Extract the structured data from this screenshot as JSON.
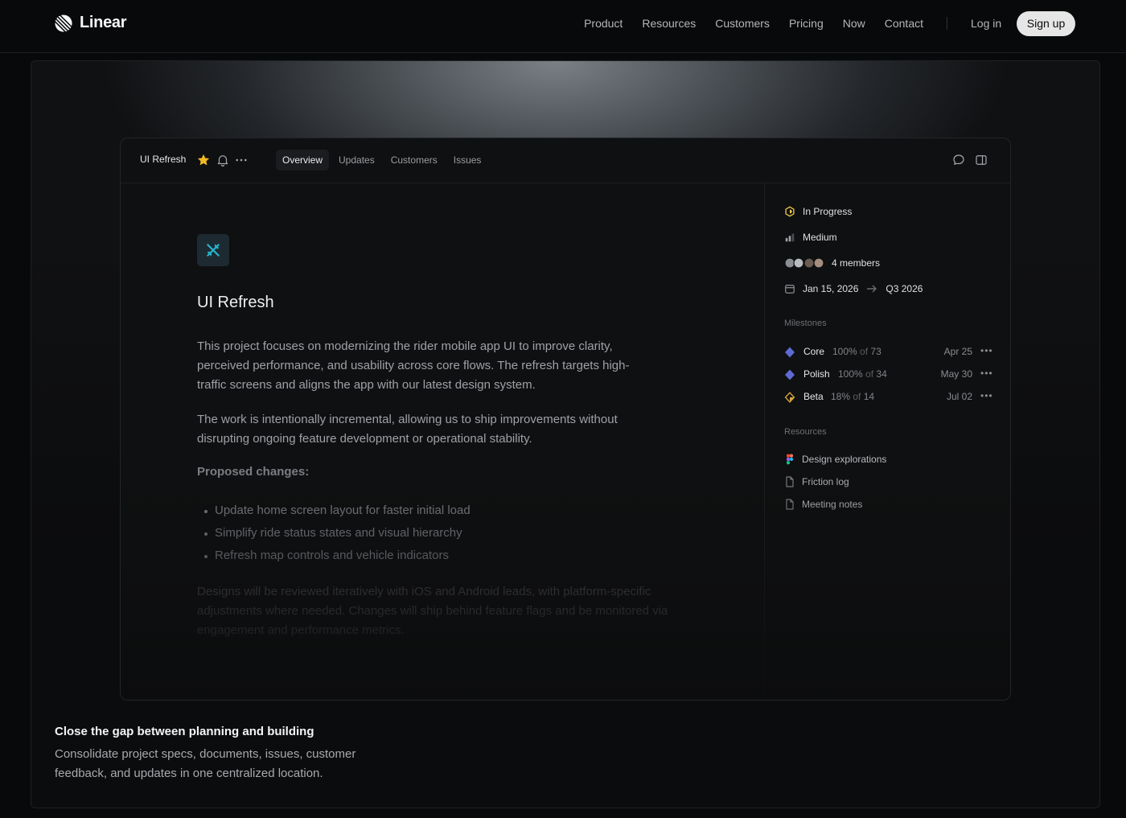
{
  "nav": {
    "logo_text": "Linear",
    "links": [
      "Product",
      "Resources",
      "Customers",
      "Pricing",
      "Now",
      "Contact"
    ],
    "login": "Log in",
    "signup": "Sign up"
  },
  "app": {
    "breadcrumb": "UI Refresh",
    "tabs": [
      "Overview",
      "Updates",
      "Customers",
      "Issues"
    ],
    "active_tab": "Overview",
    "project": {
      "title": "UI Refresh",
      "paragraph1": "This project focuses on modernizing the rider mobile app UI to improve clarity, perceived performance, and usability across core flows. The refresh targets high-traffic screens and aligns the app with our latest design system.",
      "paragraph2": "The work is intentionally incremental, allowing us to ship improvements without disrupting ongoing feature development or operational stability.",
      "subheading": "Proposed changes:",
      "bullets": [
        "Update home screen layout for faster initial load",
        "Simplify ride status states and visual hierarchy",
        "Refresh map controls and vehicle indicators"
      ],
      "paragraph3": "Designs will be reviewed iteratively with iOS and Android leads, with platform-specific adjustments where needed. Changes will ship behind feature flags and be monitored via engagement and performance metrics."
    },
    "properties": {
      "status": "In Progress",
      "priority": "Medium",
      "members": "4 members",
      "start_date": "Jan 15, 2026",
      "target_date": "Q3 2026"
    },
    "milestones_label": "Milestones",
    "milestones": [
      {
        "name": "Core",
        "pct": "100%",
        "of": "of",
        "total": "73",
        "date": "Apr 25",
        "color": "#5e6ad2"
      },
      {
        "name": "Polish",
        "pct": "100%",
        "of": "of",
        "total": "34",
        "date": "May 30",
        "color": "#5e6ad2"
      },
      {
        "name": "Beta",
        "pct": "18%",
        "of": "of",
        "total": "14",
        "date": "Jul 02",
        "color": "#d4a33c"
      }
    ],
    "resources_label": "Resources",
    "resources": [
      "Design explorations",
      "Friction log",
      "Meeting notes"
    ]
  },
  "caption": {
    "title": "Close the gap between planning and building",
    "text": "Consolidate project specs, documents, issues, customer feedback, and updates in one centralized location."
  },
  "colors": {
    "accent": "#5e6ad2",
    "status_yellow": "#f2c94c",
    "star": "#f2b924",
    "project_icon": "#26b5ce"
  },
  "icons": [
    "linear-logo-icon",
    "star-icon",
    "bell-icon",
    "more-icon",
    "comment-icon",
    "panel-icon",
    "project-icon",
    "status-in-progress-icon",
    "priority-medium-icon",
    "avatars",
    "calendar-icon",
    "arrow-right-icon",
    "diamond-icon",
    "figma-icon",
    "document-icon"
  ]
}
